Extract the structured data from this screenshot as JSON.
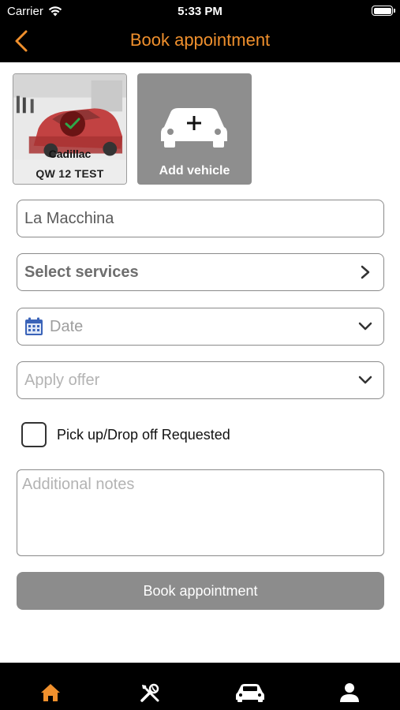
{
  "status_bar": {
    "carrier": "Carrier",
    "time": "5:33 PM"
  },
  "nav": {
    "title": "Book appointment",
    "back_icon": "chevron-left-icon"
  },
  "vehicles": [
    {
      "make": "Cadillac",
      "plate": "QW 12 TEST",
      "selected": true
    },
    {
      "add_label": "Add vehicle"
    }
  ],
  "form": {
    "garage": "La Macchina",
    "services_label": "Select services",
    "date_placeholder": "Date",
    "offer_placeholder": "Apply offer",
    "pickup_label": "Pick up/Drop off Requested",
    "pickup_checked": false,
    "notes_placeholder": "Additional notes",
    "submit_label": "Book appointment"
  },
  "tabs": [
    {
      "icon": "home-icon",
      "active": true
    },
    {
      "icon": "tools-icon",
      "active": false
    },
    {
      "icon": "car-icon",
      "active": false
    },
    {
      "icon": "user-icon",
      "active": false
    }
  ],
  "colors": {
    "accent": "#f0902d",
    "button_gray": "#8c8c8c",
    "bar": "#000000"
  }
}
